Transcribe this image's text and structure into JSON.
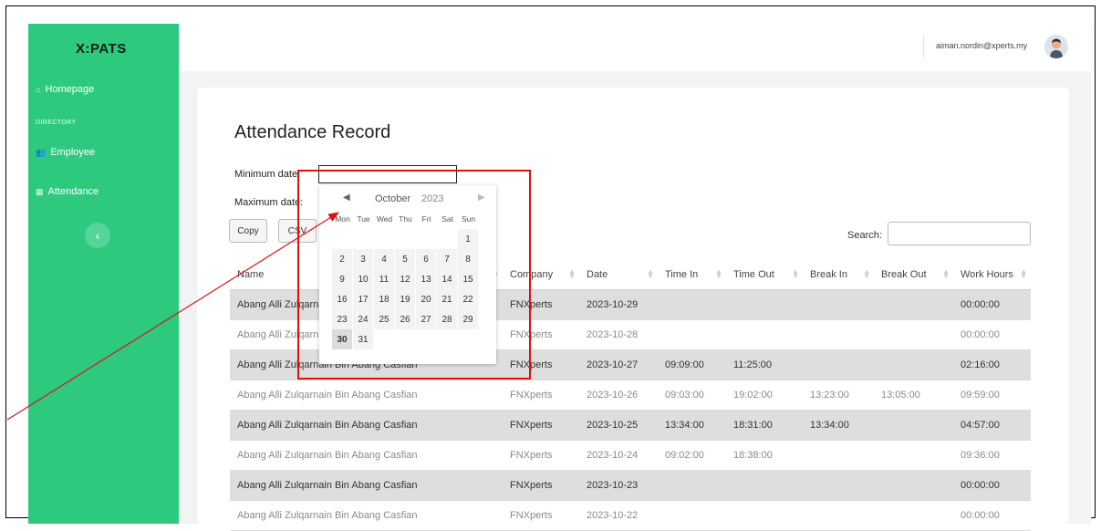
{
  "app": {
    "logo": "X:PATS",
    "user_email": "aiman.nordin@xperts.my"
  },
  "sidebar": {
    "section_label": "DIRECTORY",
    "items": [
      {
        "label": "Homepage",
        "icon": "home-icon"
      },
      {
        "label": "Employee",
        "icon": "users-icon"
      },
      {
        "label": "Attendance",
        "icon": "calendar-icon"
      }
    ],
    "collapse_symbol": "‹"
  },
  "page": {
    "title": "Attendance Record",
    "min_date_label": "Minimum date:",
    "max_date_label": "Maximum date:",
    "min_date_value": "",
    "buttons": [
      "Copy",
      "CSV"
    ],
    "search_label": "Search:",
    "search_value": ""
  },
  "calendar": {
    "month": "October",
    "year": "2023",
    "dows": [
      "Mon",
      "Tue",
      "Wed",
      "Thu",
      "Fri",
      "Sat",
      "Sun"
    ],
    "leading_blanks": 6,
    "days_in_month": 31,
    "selected_day": 30
  },
  "table": {
    "columns": [
      "Name",
      "Company",
      "Date",
      "Time In",
      "Time Out",
      "Break In",
      "Break Out",
      "Work Hours"
    ],
    "rows": [
      [
        "Abang Alli Zulqarnain Bin Abang Casfian",
        "FNXperts",
        "2023-10-29",
        "",
        "",
        "",
        "",
        "00:00:00"
      ],
      [
        "Abang Alli Zulqarnain Bin Abang Casfian",
        "FNXperts",
        "2023-10-28",
        "",
        "",
        "",
        "",
        "00:00:00"
      ],
      [
        "Abang Alli Zulqarnain Bin Abang Casfian",
        "FNXperts",
        "2023-10-27",
        "09:09:00",
        "11:25:00",
        "",
        "",
        "02:16:00"
      ],
      [
        "Abang Alli Zulqarnain Bin Abang Casfian",
        "FNXperts",
        "2023-10-26",
        "09:03:00",
        "19:02:00",
        "13:23:00",
        "13:05:00",
        "09:59:00"
      ],
      [
        "Abang Alli Zulqarnain Bin Abang Casfian",
        "FNXperts",
        "2023-10-25",
        "13:34:00",
        "18:31:00",
        "13:34:00",
        "",
        "04:57:00"
      ],
      [
        "Abang Alli Zulqarnain Bin Abang Casfian",
        "FNXperts",
        "2023-10-24",
        "09:02:00",
        "18:38:00",
        "",
        "",
        "09:36:00"
      ],
      [
        "Abang Alli Zulqarnain Bin Abang Casfian",
        "FNXperts",
        "2023-10-23",
        "",
        "",
        "",
        "",
        "00:00:00"
      ],
      [
        "Abang Alli Zulqarnain Bin Abang Casfian",
        "FNXperts",
        "2023-10-22",
        "",
        "",
        "",
        "",
        "00:00:00"
      ]
    ]
  },
  "colors": {
    "sidebar": "#2dc97e",
    "annotation": "#e01010",
    "row_shaded": "#dedede"
  }
}
